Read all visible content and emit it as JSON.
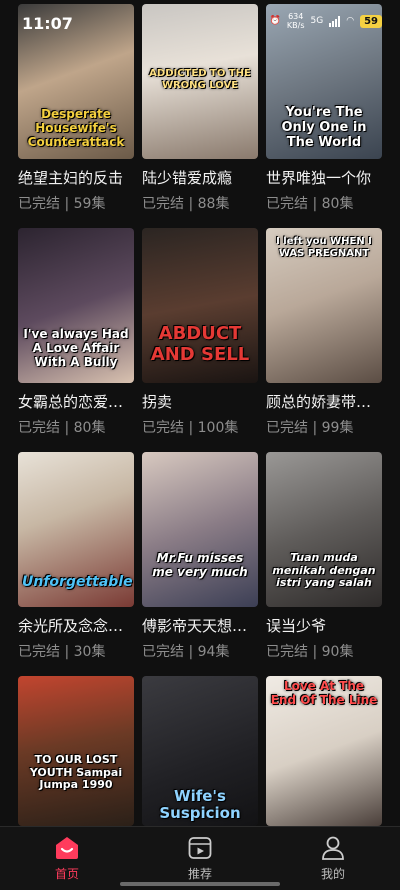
{
  "status": {
    "time": "11:07",
    "speed_top": "634",
    "speed_unit": "KB/s",
    "net": "5G",
    "battery": "59"
  },
  "dramas": [
    {
      "title": "绝望主妇的反击",
      "status": "已完结",
      "episodes": "59集",
      "art": "Desperate Housewife's Counterattack",
      "art_color": "#f4d03f",
      "bg": "linear-gradient(160deg,#3b3b3b 0%,#bfa58a 45%,#6b5a48 100%)"
    },
    {
      "title": "陆少错爱成瘾",
      "status": "已完结",
      "episodes": "88集",
      "art": "ADDICTED TO THE WRONG LOVE",
      "art_color": "#ffe082",
      "bg": "linear-gradient(170deg,#c9c6c2 0%,#e8e1d8 40%,#8a7a6d 100%)"
    },
    {
      "title": "世界唯独一个你",
      "status": "已完结",
      "episodes": "80集",
      "art": "You're The Only One in The World",
      "art_color": "#ffffff",
      "bg": "linear-gradient(160deg,#9aa7b3 0%,#6d7680 50%,#3b4450 100%)"
    },
    {
      "title": "女霸总的恋爱…",
      "status": "已完结",
      "episodes": "80集",
      "art": "I've always Had A Love Affair With A Bully",
      "art_color": "#ffffff",
      "bg": "linear-gradient(160deg,#2c2430 0%,#5d4a5e 50%,#d9c2b0 100%)"
    },
    {
      "title": "拐卖",
      "status": "已完结",
      "episodes": "100集",
      "art": "ABDUCT AND SELL",
      "art_color": "#e53935",
      "bg": "linear-gradient(170deg,#2b2522 0%,#5a3d30 50%,#1a1412 100%)"
    },
    {
      "title": "顾总的娇妻带…",
      "status": "已完结",
      "episodes": "99集",
      "art": "I left you WHEN I WAS PREGNANT",
      "art_color": "#ffffff",
      "bg": "linear-gradient(160deg,#d6ccc0 0%,#b9a899 45%,#5b4d44 100%)"
    },
    {
      "title": "余光所及念念…",
      "status": "已完结",
      "episodes": "30集",
      "art": "Unforgettable",
      "art_color": "#4fc3f7",
      "bg": "linear-gradient(160deg,#e8e2d8 0%,#c7b7a4 40%,#7a3a34 100%)"
    },
    {
      "title": "傅影帝天天想…",
      "status": "已完结",
      "episodes": "94集",
      "art": "Mr.Fu misses me very much",
      "art_color": "#ffffff",
      "bg": "linear-gradient(160deg,#d8c9c0 0%,#8a7c86 50%,#3c3f55 100%)"
    },
    {
      "title": "误当少爷",
      "status": "已完结",
      "episodes": "90集",
      "art": "Tuan muda menikah dengan istri yang salah",
      "art_color": "#ffffff",
      "bg": "linear-gradient(160deg,#9a9896 0%,#5f5c5a 50%,#2e2b2a 100%)"
    },
    {
      "title": "",
      "status": "",
      "episodes": "",
      "art": "TO OUR LOST YOUTH Sampai Jumpa 1990",
      "art_color": "#ffffff",
      "bg": "linear-gradient(170deg,#c2452f 0%,#6b3a25 45%,#2b2018 100%)"
    },
    {
      "title": "",
      "status": "",
      "episodes": "",
      "art": "Wife's Suspicion",
      "art_color": "#8fd3ff",
      "bg": "linear-gradient(160deg,#3b3b40 0%,#202024 60%,#121214 100%)"
    },
    {
      "title": "",
      "status": "",
      "episodes": "",
      "art": "Love At The End Of The Line",
      "art_color": "#ff4d4d",
      "bg": "linear-gradient(160deg,#f0ebe4 0%,#d8cfc4 50%,#4a3f3a 100%)"
    }
  ],
  "nav": [
    {
      "label": "首页",
      "icon": "home-icon",
      "active": true
    },
    {
      "label": "推荐",
      "icon": "recommend-icon",
      "active": false
    },
    {
      "label": "我的",
      "icon": "profile-icon",
      "active": false
    }
  ],
  "colors": {
    "accent": "#ff3b5c",
    "bg": "#101010",
    "meta": "#8d8d8d"
  }
}
